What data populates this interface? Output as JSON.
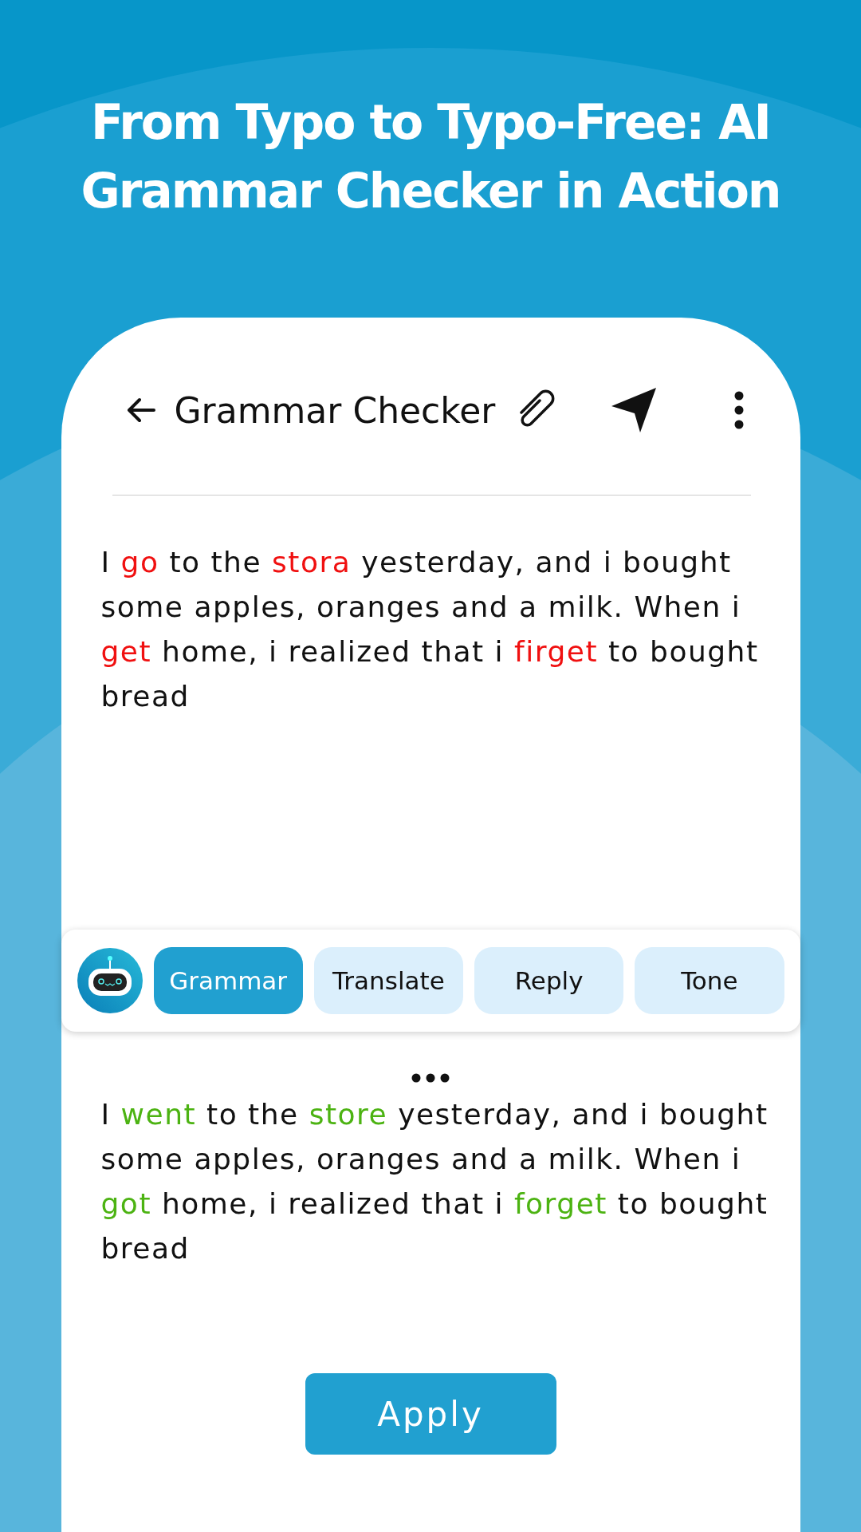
{
  "headline": "From Typo to Typo-Free: AI Grammar Checker in Action",
  "header": {
    "title": "Grammar Checker"
  },
  "input_text": [
    {
      "text": "I ",
      "kind": "plain"
    },
    {
      "text": "go",
      "kind": "error"
    },
    {
      "text": " to the ",
      "kind": "plain"
    },
    {
      "text": "stora",
      "kind": "error"
    },
    {
      "text": " yesterday, and i bought some apples, oranges and a milk. When i ",
      "kind": "plain"
    },
    {
      "text": "get",
      "kind": "error"
    },
    {
      "text": " home, i realized that i ",
      "kind": "plain"
    },
    {
      "text": "firget",
      "kind": "error"
    },
    {
      "text": " to bought bread",
      "kind": "plain"
    }
  ],
  "tools": [
    {
      "label": "Grammar",
      "selected": true
    },
    {
      "label": "Translate",
      "selected": false
    },
    {
      "label": "Reply",
      "selected": false
    },
    {
      "label": "Tone",
      "selected": false
    }
  ],
  "result_text": [
    {
      "text": "I ",
      "kind": "plain"
    },
    {
      "text": "went",
      "kind": "fix"
    },
    {
      "text": " to the ",
      "kind": "plain"
    },
    {
      "text": "store",
      "kind": "fix"
    },
    {
      "text": " yesterday, and i bought some apples, oranges and a milk. When i ",
      "kind": "plain"
    },
    {
      "text": "got",
      "kind": "fix"
    },
    {
      "text": " home, i realized that i ",
      "kind": "plain"
    },
    {
      "text": "forget",
      "kind": "fix"
    },
    {
      "text": " to bought bread",
      "kind": "plain"
    }
  ],
  "apply_button": "Apply"
}
